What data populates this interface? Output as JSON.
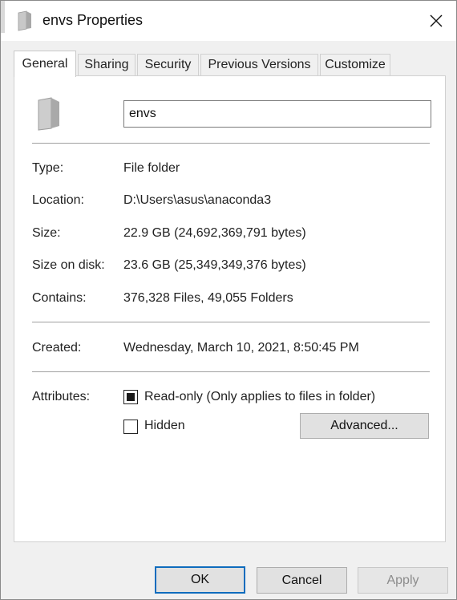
{
  "window": {
    "title": "envs Properties"
  },
  "tabs": [
    {
      "label": "General",
      "active": true
    },
    {
      "label": "Sharing"
    },
    {
      "label": "Security"
    },
    {
      "label": "Previous Versions"
    },
    {
      "label": "Customize"
    }
  ],
  "general": {
    "folder_name": "envs",
    "type": {
      "label": "Type:",
      "value": "File folder"
    },
    "location": {
      "label": "Location:",
      "value": "D:\\Users\\asus\\anaconda3"
    },
    "size": {
      "label": "Size:",
      "value": "22.9 GB (24,692,369,791 bytes)"
    },
    "size_on_disk": {
      "label": "Size on disk:",
      "value": "23.6 GB (25,349,349,376 bytes)"
    },
    "contains": {
      "label": "Contains:",
      "value": "376,328 Files, 49,055 Folders"
    },
    "created": {
      "label": "Created:",
      "value": "Wednesday, March 10, 2021, 8:50:45 PM"
    },
    "attributes": {
      "label": "Attributes:",
      "read_only": {
        "label": "Read-only (Only applies to files in folder)",
        "state": "indeterminate"
      },
      "hidden": {
        "label": "Hidden",
        "state": "unchecked"
      },
      "advanced_label": "Advanced..."
    }
  },
  "footer": {
    "ok": "OK",
    "cancel": "Cancel",
    "apply": "Apply"
  },
  "icons": {
    "title": "folder-icon",
    "close": "close-icon",
    "folder": "folder-icon"
  },
  "colors": {
    "default_button_border": "#0f6cbd",
    "window_bg": "#f0f0f0"
  }
}
